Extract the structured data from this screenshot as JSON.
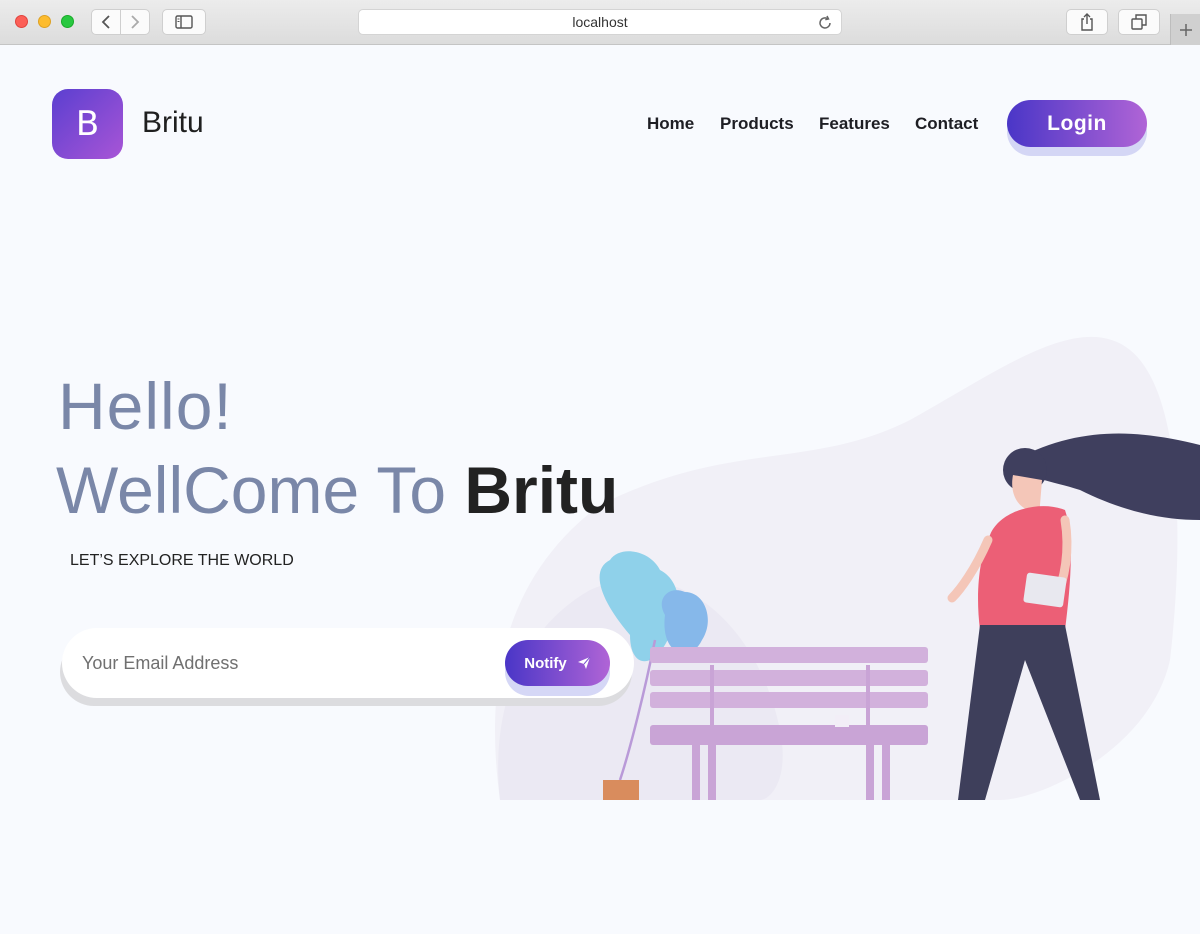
{
  "browser": {
    "url": "localhost"
  },
  "site": {
    "logo_letter": "B",
    "brand_name": "Britu"
  },
  "nav": {
    "items": [
      "Home",
      "Products",
      "Features",
      "Contact"
    ],
    "login_label": "Login"
  },
  "hero": {
    "greeting": "Hello!",
    "welcome_prefix": "WellCome To ",
    "welcome_brand": "Britu",
    "tagline": "LET’S EXPLORE THE WORLD"
  },
  "subscribe": {
    "email_value": "",
    "email_placeholder": "Your Email Address",
    "notify_label": "Notify"
  },
  "colors": {
    "accent_start": "#4a36c7",
    "accent_end": "#b064d6",
    "hero_text": "#7a87a8",
    "background": "#f8fafe"
  }
}
